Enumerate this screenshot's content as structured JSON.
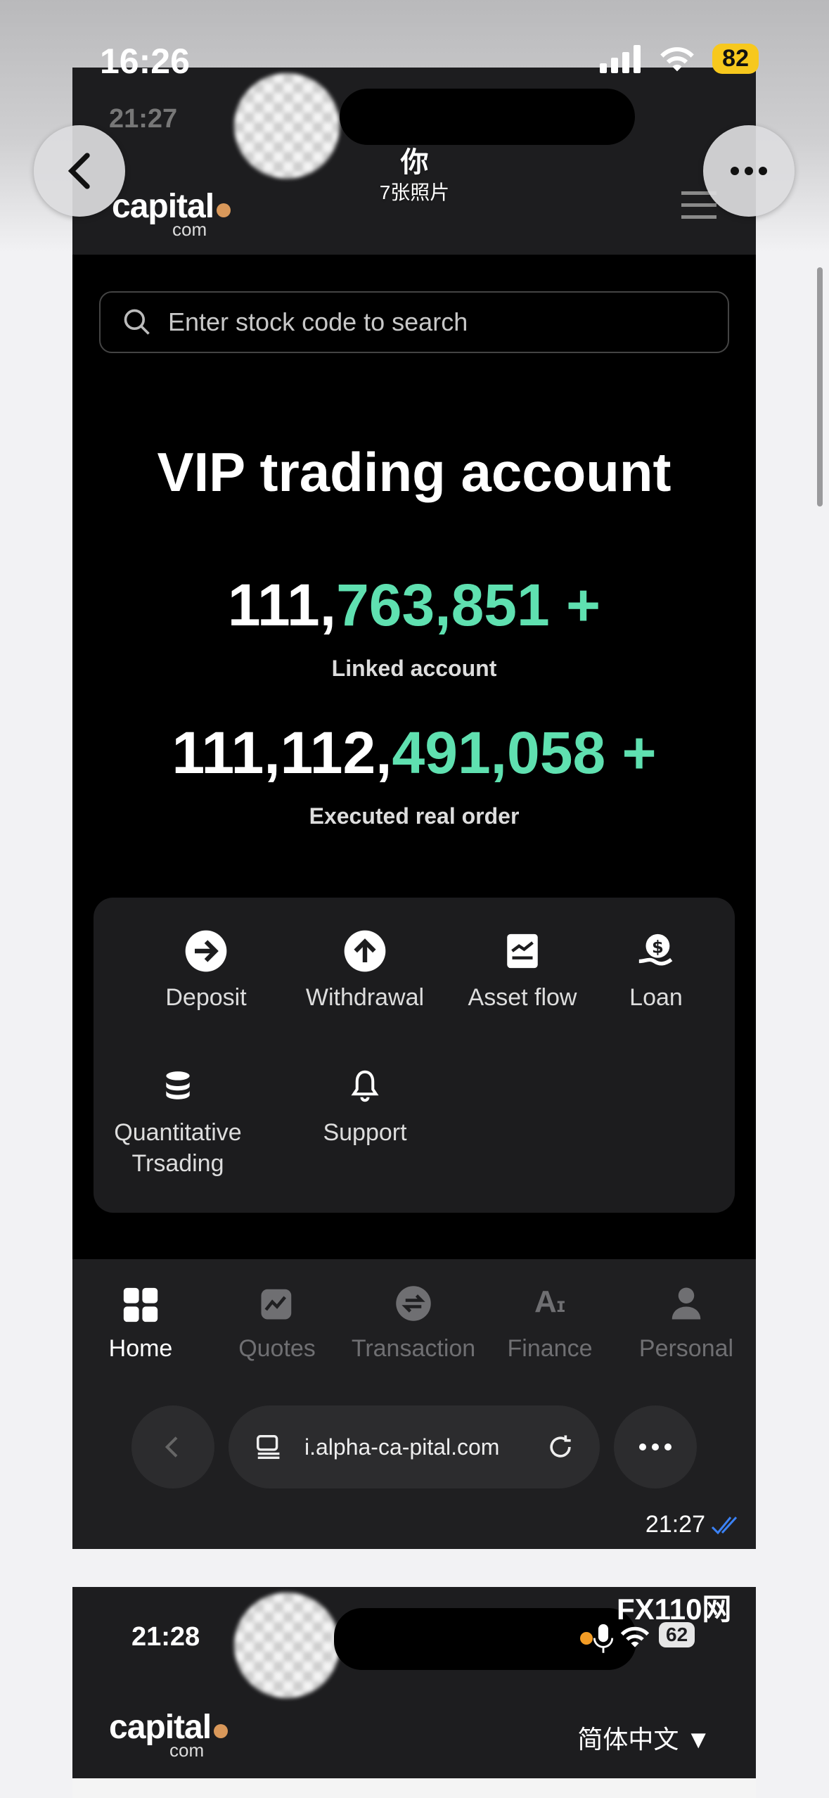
{
  "status_bar": {
    "time": "16:26",
    "battery": "82"
  },
  "viewer": {
    "title": "你",
    "subtitle": "7张照片"
  },
  "shot1": {
    "inner_time": "21:27",
    "logo": {
      "name": "capital",
      "suffix": "com"
    },
    "search_placeholder": "Enter stock code to search",
    "headline": "VIP trading account",
    "stats": [
      {
        "value_white": "111,",
        "value_green": "763,851",
        "plus": " +",
        "label": "Linked account"
      },
      {
        "value_white": "111,112,",
        "value_green": "491,058",
        "plus": " +",
        "label": "Executed real order"
      }
    ],
    "actions": [
      {
        "label": "Deposit",
        "icon": "arrow-right-circle-icon"
      },
      {
        "label": "Withdrawal",
        "icon": "arrow-up-circle-icon"
      },
      {
        "label": "Asset flow",
        "icon": "chart-doc-icon"
      },
      {
        "label": "Loan",
        "icon": "money-bag-icon"
      },
      {
        "label": "Quantitative\nTrsading",
        "icon": "database-icon"
      },
      {
        "label": "Support",
        "icon": "bell-icon"
      }
    ],
    "tabs": [
      {
        "label": "Home",
        "icon": "grid-icon",
        "active": true
      },
      {
        "label": "Quotes",
        "icon": "chart-icon"
      },
      {
        "label": "Transaction",
        "icon": "exchange-icon"
      },
      {
        "label": "Finance",
        "icon": "ai-icon"
      },
      {
        "label": "Personal",
        "icon": "person-icon"
      }
    ],
    "url": "i.alpha-ca-pital.com",
    "message_time": "21:27"
  },
  "shot2": {
    "inner_time": "21:28",
    "battery": "62",
    "watermark": "FX110网",
    "language": "简体中文 ▼"
  },
  "colors": {
    "accent_green": "#5fe0b0",
    "battery_yellow": "#f7c81d",
    "tick_blue": "#3b82f6"
  }
}
